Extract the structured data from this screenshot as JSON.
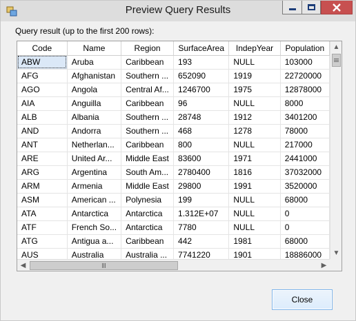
{
  "window": {
    "title": "Preview Query Results",
    "caption": "Query result (up to the first 200 rows):"
  },
  "icons": {
    "app": "app-window-icon",
    "minimize": "minimize-icon",
    "maximize": "maximize-icon",
    "close": "close-icon"
  },
  "grid": {
    "columns": [
      "Code",
      "Name",
      "Region",
      "SurfaceArea",
      "IndepYear",
      "Population"
    ],
    "rows": [
      [
        "ABW",
        "Aruba",
        "Caribbean",
        "193",
        "NULL",
        "103000"
      ],
      [
        "AFG",
        "Afghanistan",
        "Southern ...",
        "652090",
        "1919",
        "22720000"
      ],
      [
        "AGO",
        "Angola",
        "Central Af...",
        "1246700",
        "1975",
        "12878000"
      ],
      [
        "AIA",
        "Anguilla",
        "Caribbean",
        "96",
        "NULL",
        "8000"
      ],
      [
        "ALB",
        "Albania",
        "Southern ...",
        "28748",
        "1912",
        "3401200"
      ],
      [
        "AND",
        "Andorra",
        "Southern ...",
        "468",
        "1278",
        "78000"
      ],
      [
        "ANT",
        "Netherlan...",
        "Caribbean",
        "800",
        "NULL",
        "217000"
      ],
      [
        "ARE",
        "United Ar...",
        "Middle East",
        "83600",
        "1971",
        "2441000"
      ],
      [
        "ARG",
        "Argentina",
        "South Am...",
        "2780400",
        "1816",
        "37032000"
      ],
      [
        "ARM",
        "Armenia",
        "Middle East",
        "29800",
        "1991",
        "3520000"
      ],
      [
        "ASM",
        "American ...",
        "Polynesia",
        "199",
        "NULL",
        "68000"
      ],
      [
        "ATA",
        "Antarctica",
        "Antarctica",
        "1.312E+07",
        "NULL",
        "0"
      ],
      [
        "ATF",
        "French So...",
        "Antarctica",
        "7780",
        "NULL",
        "0"
      ],
      [
        "ATG",
        "Antigua a...",
        "Caribbean",
        "442",
        "1981",
        "68000"
      ],
      [
        "AUS",
        "Australia",
        "Australia ...",
        "7741220",
        "1901",
        "18886000"
      ]
    ]
  },
  "buttons": {
    "close_label": "Close"
  },
  "colors": {
    "close_button_bg": "#c75050",
    "selected_cell": "#dbe8f7"
  }
}
